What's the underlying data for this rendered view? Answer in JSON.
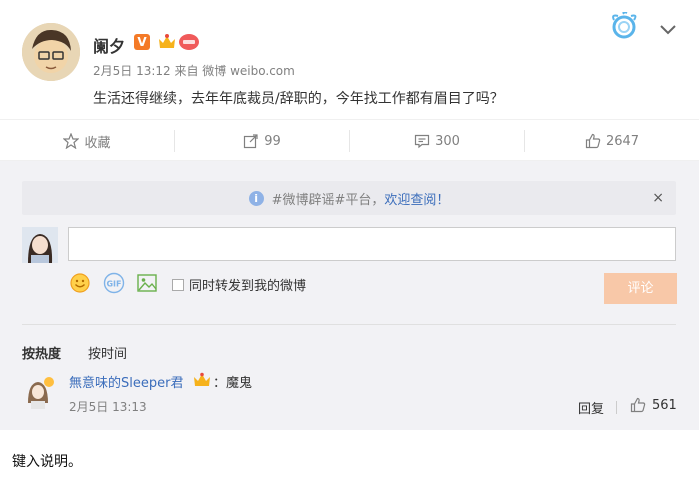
{
  "post": {
    "username": "阑夕",
    "v_badge": "V",
    "meta": "2月5日 13:12 来自 微博 weibo.com",
    "content": "生活还得继续，去年年底裁员/辞职的，今年找工作都有眉目了吗？"
  },
  "actions": {
    "favorite_label": "收藏",
    "repost_count": "99",
    "comment_count": "300",
    "like_count": "2647"
  },
  "comment_box": {
    "notice_prefix": "#微博辟谣#平台，",
    "notice_link": "欢迎查阅！",
    "notice_close": "×",
    "input_value": "",
    "repost_checkbox_label": "同时转发到我的微博",
    "submit_label": "评论"
  },
  "sort": {
    "hot_label": "按热度",
    "time_label": "按时间"
  },
  "comments": [
    {
      "user": "無意味的Sleeper君",
      "separator": "：",
      "text": "魔鬼",
      "time": "2月5日 13:13",
      "reply_label": "回复",
      "likes": "561"
    }
  ],
  "caption": "键入说明。",
  "colors": {
    "accent_orange": "#f47a27",
    "link_blue": "#3b6dbb",
    "submit_disabled": "#f8c8a8"
  }
}
